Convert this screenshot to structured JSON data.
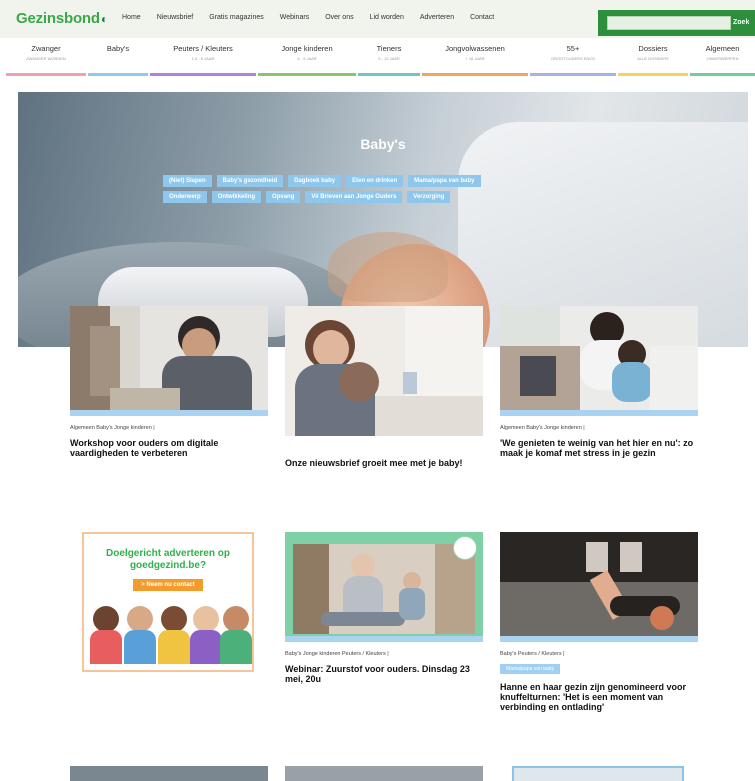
{
  "logo": {
    "text": "Gezinsbond"
  },
  "topnav": [
    "Home",
    "Nieuwsbrief",
    "Gratis magazines",
    "Webinars",
    "Over ons",
    "Lid worden",
    "Adverteren",
    "Contact"
  ],
  "search": {
    "button": "Zoek"
  },
  "categories": [
    {
      "label": "Zwanger",
      "sub": "ZWANGER WORDEN",
      "color": "#f29fb0"
    },
    {
      "label": "Baby's",
      "sub": "",
      "color": "#8ec9ee"
    },
    {
      "label": "Peuters / Kleuters",
      "sub": "1,5 - 6 JAAR",
      "color": "#b47fe0"
    },
    {
      "label": "Jonge kinderen",
      "sub": "6 - 9 JAAR",
      "color": "#86c46f"
    },
    {
      "label": "Tieners",
      "sub": "9 - 12 JAAR",
      "color": "#6fc8c0"
    },
    {
      "label": "Jongvolwassenen",
      "sub": "+ 18 JAAR",
      "color": "#f5a25b"
    },
    {
      "label": "55+",
      "sub": "GROOTOUDERS ENZO",
      "color": "#a7b3e6"
    },
    {
      "label": "Dossiers",
      "sub": "ALLE DOSSIERS",
      "color": "#f4d35e"
    },
    {
      "label": "Algemeen",
      "sub": "ONDERWERPEN",
      "color": "#6dcf9b"
    }
  ],
  "hero": {
    "title": "Baby's",
    "tags": [
      "(Niet) Slapen",
      "Baby's gezondheid",
      "Dagboek baby",
      "Eten en drinken",
      "Mama/papa van baby",
      "Onderwerp",
      "Ontwikkeling",
      "Opvang",
      "Vii Brieven aan Jonge Ouders",
      "Verzorging"
    ]
  },
  "cards": [
    {
      "meta": "Algemeen Baby's Jonge kinderen |",
      "title": "Workshop voor ouders om digitale vaardigheden te verbeteren",
      "tag": ""
    },
    {
      "meta": "",
      "title": "Onze nieuwsbrief groeit mee met je baby!",
      "tag": ""
    },
    {
      "meta": "Algemeen Baby's Jonge kinderen |",
      "title": "'We genieten te weinig van het hier en nu': zo maak je komaf met stress in je gezin",
      "tag": ""
    },
    {
      "meta": "Baby's Jonge kinderen Peuters / Kleuters |",
      "title": "Webinar: Zuurstof voor ouders. Dinsdag 23 mei, 20u",
      "tag": ""
    },
    {
      "meta": "Baby's Peuters / Kleuters |",
      "title": "Hanne en haar gezin zijn genomineerd voor knuffelturnen: 'Het is een moment van verbinding en ontlading'",
      "tag": "Mama/papa van baby"
    }
  ],
  "ad": {
    "headline": "Doelgericht adverteren op goedgezind.be?",
    "button": "> Neem nu contact"
  }
}
